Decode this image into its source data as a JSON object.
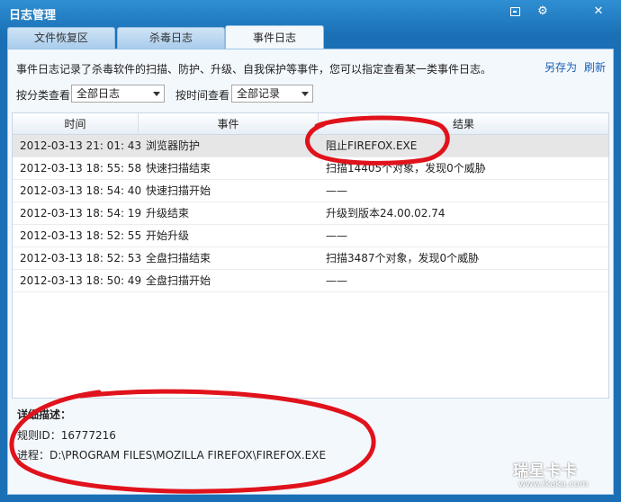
{
  "window": {
    "title": "日志管理",
    "minimize_icon": "minimize-box-icon",
    "gear_icon": "gear-icon",
    "close_label": "✕"
  },
  "tabs": [
    {
      "label": "文件恢复区",
      "active": false
    },
    {
      "label": "杀毒日志",
      "active": false
    },
    {
      "label": "事件日志",
      "active": true
    }
  ],
  "header": {
    "description": "事件日志记录了杀毒软件的扫描、防护、升级、自我保护等事件，您可以指定查看某一类事件日志。",
    "save_as": "另存为",
    "refresh": "刷新"
  },
  "filters": {
    "category_label": "按分类查看",
    "category_value": "全部日志",
    "time_label": "按时间查看",
    "time_value": "全部记录"
  },
  "table": {
    "columns": [
      "时间",
      "事件",
      "结果"
    ],
    "rows": [
      {
        "time": "2012-03-13 21: 01: 43",
        "event": "浏览器防护",
        "result": "阻止FIREFOX.EXE",
        "selected": true
      },
      {
        "time": "2012-03-13 18: 55: 58",
        "event": "快速扫描结束",
        "result": "扫描14405个对象，发现0个威胁"
      },
      {
        "time": "2012-03-13 18: 54: 40",
        "event": "快速扫描开始",
        "result": "——"
      },
      {
        "time": "2012-03-13 18: 54: 19",
        "event": "升级结束",
        "result": "升级到版本24.00.02.74"
      },
      {
        "time": "2012-03-13 18: 52: 55",
        "event": "开始升级",
        "result": "——"
      },
      {
        "time": "2012-03-13 18: 52: 53",
        "event": "全盘扫描结束",
        "result": "扫描3487个对象，发现0个威胁"
      },
      {
        "time": "2012-03-13 18: 50: 49",
        "event": "全盘扫描开始",
        "result": "——"
      }
    ]
  },
  "details": {
    "title": "详细描述：",
    "rule": "规则ID：16777216",
    "process": "进程：D:\\PROGRAM FILES\\MOZILLA FIREFOX\\FIREFOX.EXE"
  },
  "annotation_color": "#e0121b",
  "watermark": {
    "main": "瑞星卡卡",
    "url": "www.ikaka.com"
  }
}
